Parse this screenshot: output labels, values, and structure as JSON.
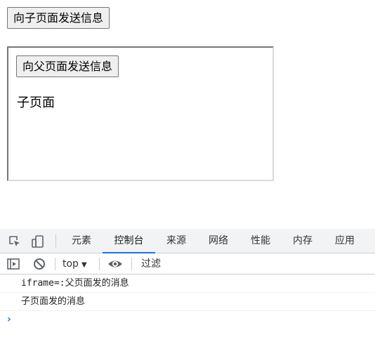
{
  "parent": {
    "send_button_label": "向子页面发送信息"
  },
  "iframe": {
    "send_button_label": "向父页面发送信息",
    "body_text": "子页面"
  },
  "devtools": {
    "tabs": [
      {
        "label": "元素",
        "active": false
      },
      {
        "label": "控制台",
        "active": true
      },
      {
        "label": "来源",
        "active": false
      },
      {
        "label": "网络",
        "active": false
      },
      {
        "label": "性能",
        "active": false
      },
      {
        "label": "内存",
        "active": false
      },
      {
        "label": "应用",
        "active": false
      }
    ],
    "toolbar": {
      "context": "top",
      "filter_placeholder": "过滤"
    },
    "logs": [
      "iframe=:父页面发的消息",
      "子页面发的消息"
    ],
    "prompt_symbol": "›",
    "accent_color": "#1a73e8"
  }
}
